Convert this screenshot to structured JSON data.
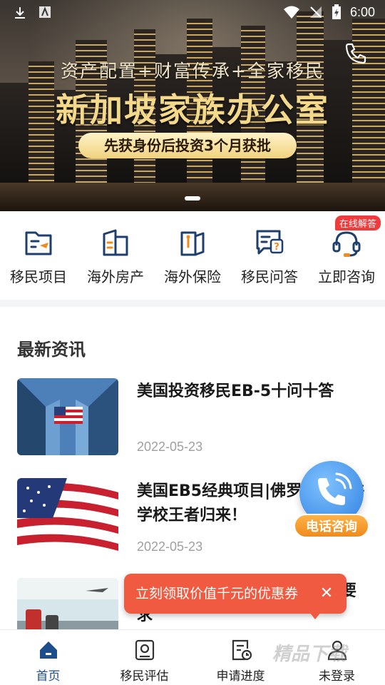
{
  "status_bar": {
    "time": "6:00"
  },
  "banner": {
    "subtitle": "资产配置+财富传承+全家移民",
    "title": "新加坡家族办公室",
    "pill": "先获身份后投资3个月获批"
  },
  "quick_nav": [
    {
      "label": "移民项目",
      "icon": "folder-plane-icon"
    },
    {
      "label": "海外房产",
      "icon": "building-icon"
    },
    {
      "label": "海外保险",
      "icon": "insurance-icon"
    },
    {
      "label": "移民问答",
      "icon": "qa-icon"
    },
    {
      "label": "立即咨询",
      "icon": "headset-icon",
      "badge": "在线解答"
    }
  ],
  "news": {
    "section_title": "最新资讯",
    "items": [
      {
        "title": "美国投资移民EB-5十问十答",
        "date": "2022-05-23"
      },
      {
        "title": "美国EB5经典项目|佛罗里达特许学校王者归来！",
        "date": "2022-05-23"
      },
      {
        "title": "核酸检测要求？取消抗体检测要求",
        "date": ""
      }
    ]
  },
  "float_call": {
    "label": "电话咨询"
  },
  "coupon": {
    "text": "立刻领取价值千元的优惠券",
    "close": "✕"
  },
  "tabbar": [
    {
      "label": "首页",
      "icon": "home-icon",
      "active": true
    },
    {
      "label": "移民评估",
      "icon": "assessment-icon"
    },
    {
      "label": "申请进度",
      "icon": "progress-icon"
    },
    {
      "label": "未登录",
      "icon": "user-icon"
    }
  ],
  "watermark": "精品下载",
  "colors": {
    "primary": "#1e4d8c",
    "accent": "#ef5a40",
    "badge": "#ef3b3b"
  }
}
